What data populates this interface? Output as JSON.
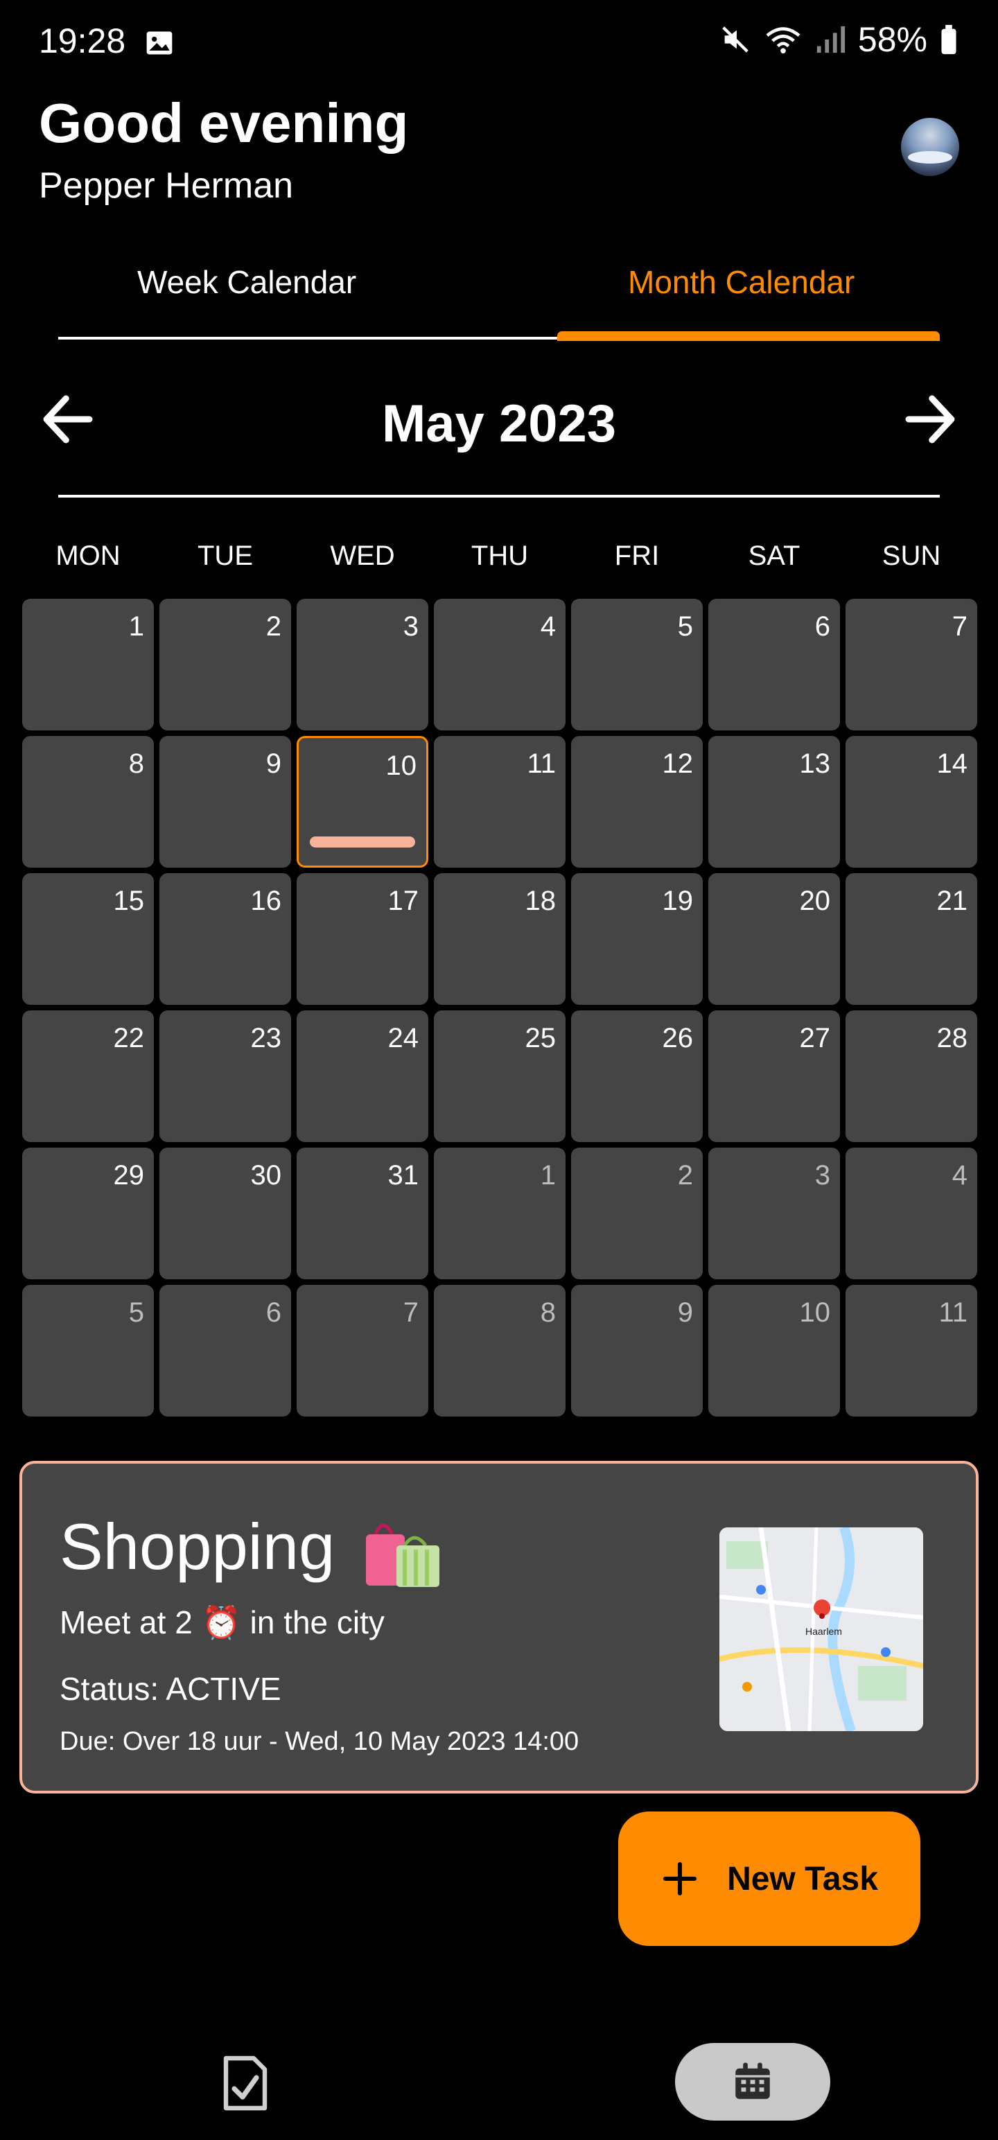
{
  "status_bar": {
    "time": "19:28",
    "battery": "58%"
  },
  "header": {
    "greeting": "Good evening",
    "user_name": "Pepper Herman"
  },
  "tabs": [
    {
      "label": "Week Calendar",
      "active": false
    },
    {
      "label": "Month Calendar",
      "active": true
    }
  ],
  "calendar": {
    "month_title": "May 2023",
    "weekdays": [
      "MON",
      "TUE",
      "WED",
      "THU",
      "FRI",
      "SAT",
      "SUN"
    ],
    "days": [
      {
        "n": "1",
        "other": false
      },
      {
        "n": "2",
        "other": false
      },
      {
        "n": "3",
        "other": false
      },
      {
        "n": "4",
        "other": false
      },
      {
        "n": "5",
        "other": false
      },
      {
        "n": "6",
        "other": false
      },
      {
        "n": "7",
        "other": false
      },
      {
        "n": "8",
        "other": false
      },
      {
        "n": "9",
        "other": false
      },
      {
        "n": "10",
        "other": false,
        "today": true,
        "has_task": true
      },
      {
        "n": "11",
        "other": false
      },
      {
        "n": "12",
        "other": false
      },
      {
        "n": "13",
        "other": false
      },
      {
        "n": "14",
        "other": false
      },
      {
        "n": "15",
        "other": false
      },
      {
        "n": "16",
        "other": false
      },
      {
        "n": "17",
        "other": false
      },
      {
        "n": "18",
        "other": false
      },
      {
        "n": "19",
        "other": false
      },
      {
        "n": "20",
        "other": false
      },
      {
        "n": "21",
        "other": false
      },
      {
        "n": "22",
        "other": false
      },
      {
        "n": "23",
        "other": false
      },
      {
        "n": "24",
        "other": false
      },
      {
        "n": "25",
        "other": false
      },
      {
        "n": "26",
        "other": false
      },
      {
        "n": "27",
        "other": false
      },
      {
        "n": "28",
        "other": false
      },
      {
        "n": "29",
        "other": false
      },
      {
        "n": "30",
        "other": false
      },
      {
        "n": "31",
        "other": false
      },
      {
        "n": "1",
        "other": true
      },
      {
        "n": "2",
        "other": true
      },
      {
        "n": "3",
        "other": true
      },
      {
        "n": "4",
        "other": true
      },
      {
        "n": "5",
        "other": true
      },
      {
        "n": "6",
        "other": true
      },
      {
        "n": "7",
        "other": true
      },
      {
        "n": "8",
        "other": true
      },
      {
        "n": "9",
        "other": true
      },
      {
        "n": "10",
        "other": true
      },
      {
        "n": "11",
        "other": true
      }
    ]
  },
  "task": {
    "title": "Shopping",
    "description": "Meet at 2 ⏰ in the city",
    "status": "Status: ACTIVE",
    "due": "Due: Over 18 uur - Wed, 10 May 2023 14:00",
    "map_label": "Haarlem"
  },
  "fab": {
    "label": "New Task"
  },
  "colors": {
    "accent": "#ff8c00",
    "cell": "#454545",
    "task_highlight": "#f8b39a",
    "background": "#000000"
  },
  "icons": [
    "image-icon",
    "mute-icon",
    "wifi-icon",
    "signal-icon",
    "battery-icon",
    "arrow-left-icon",
    "arrow-right-icon",
    "shopping-bag-icon",
    "plus-icon",
    "task-check-icon",
    "calendar-icon"
  ]
}
